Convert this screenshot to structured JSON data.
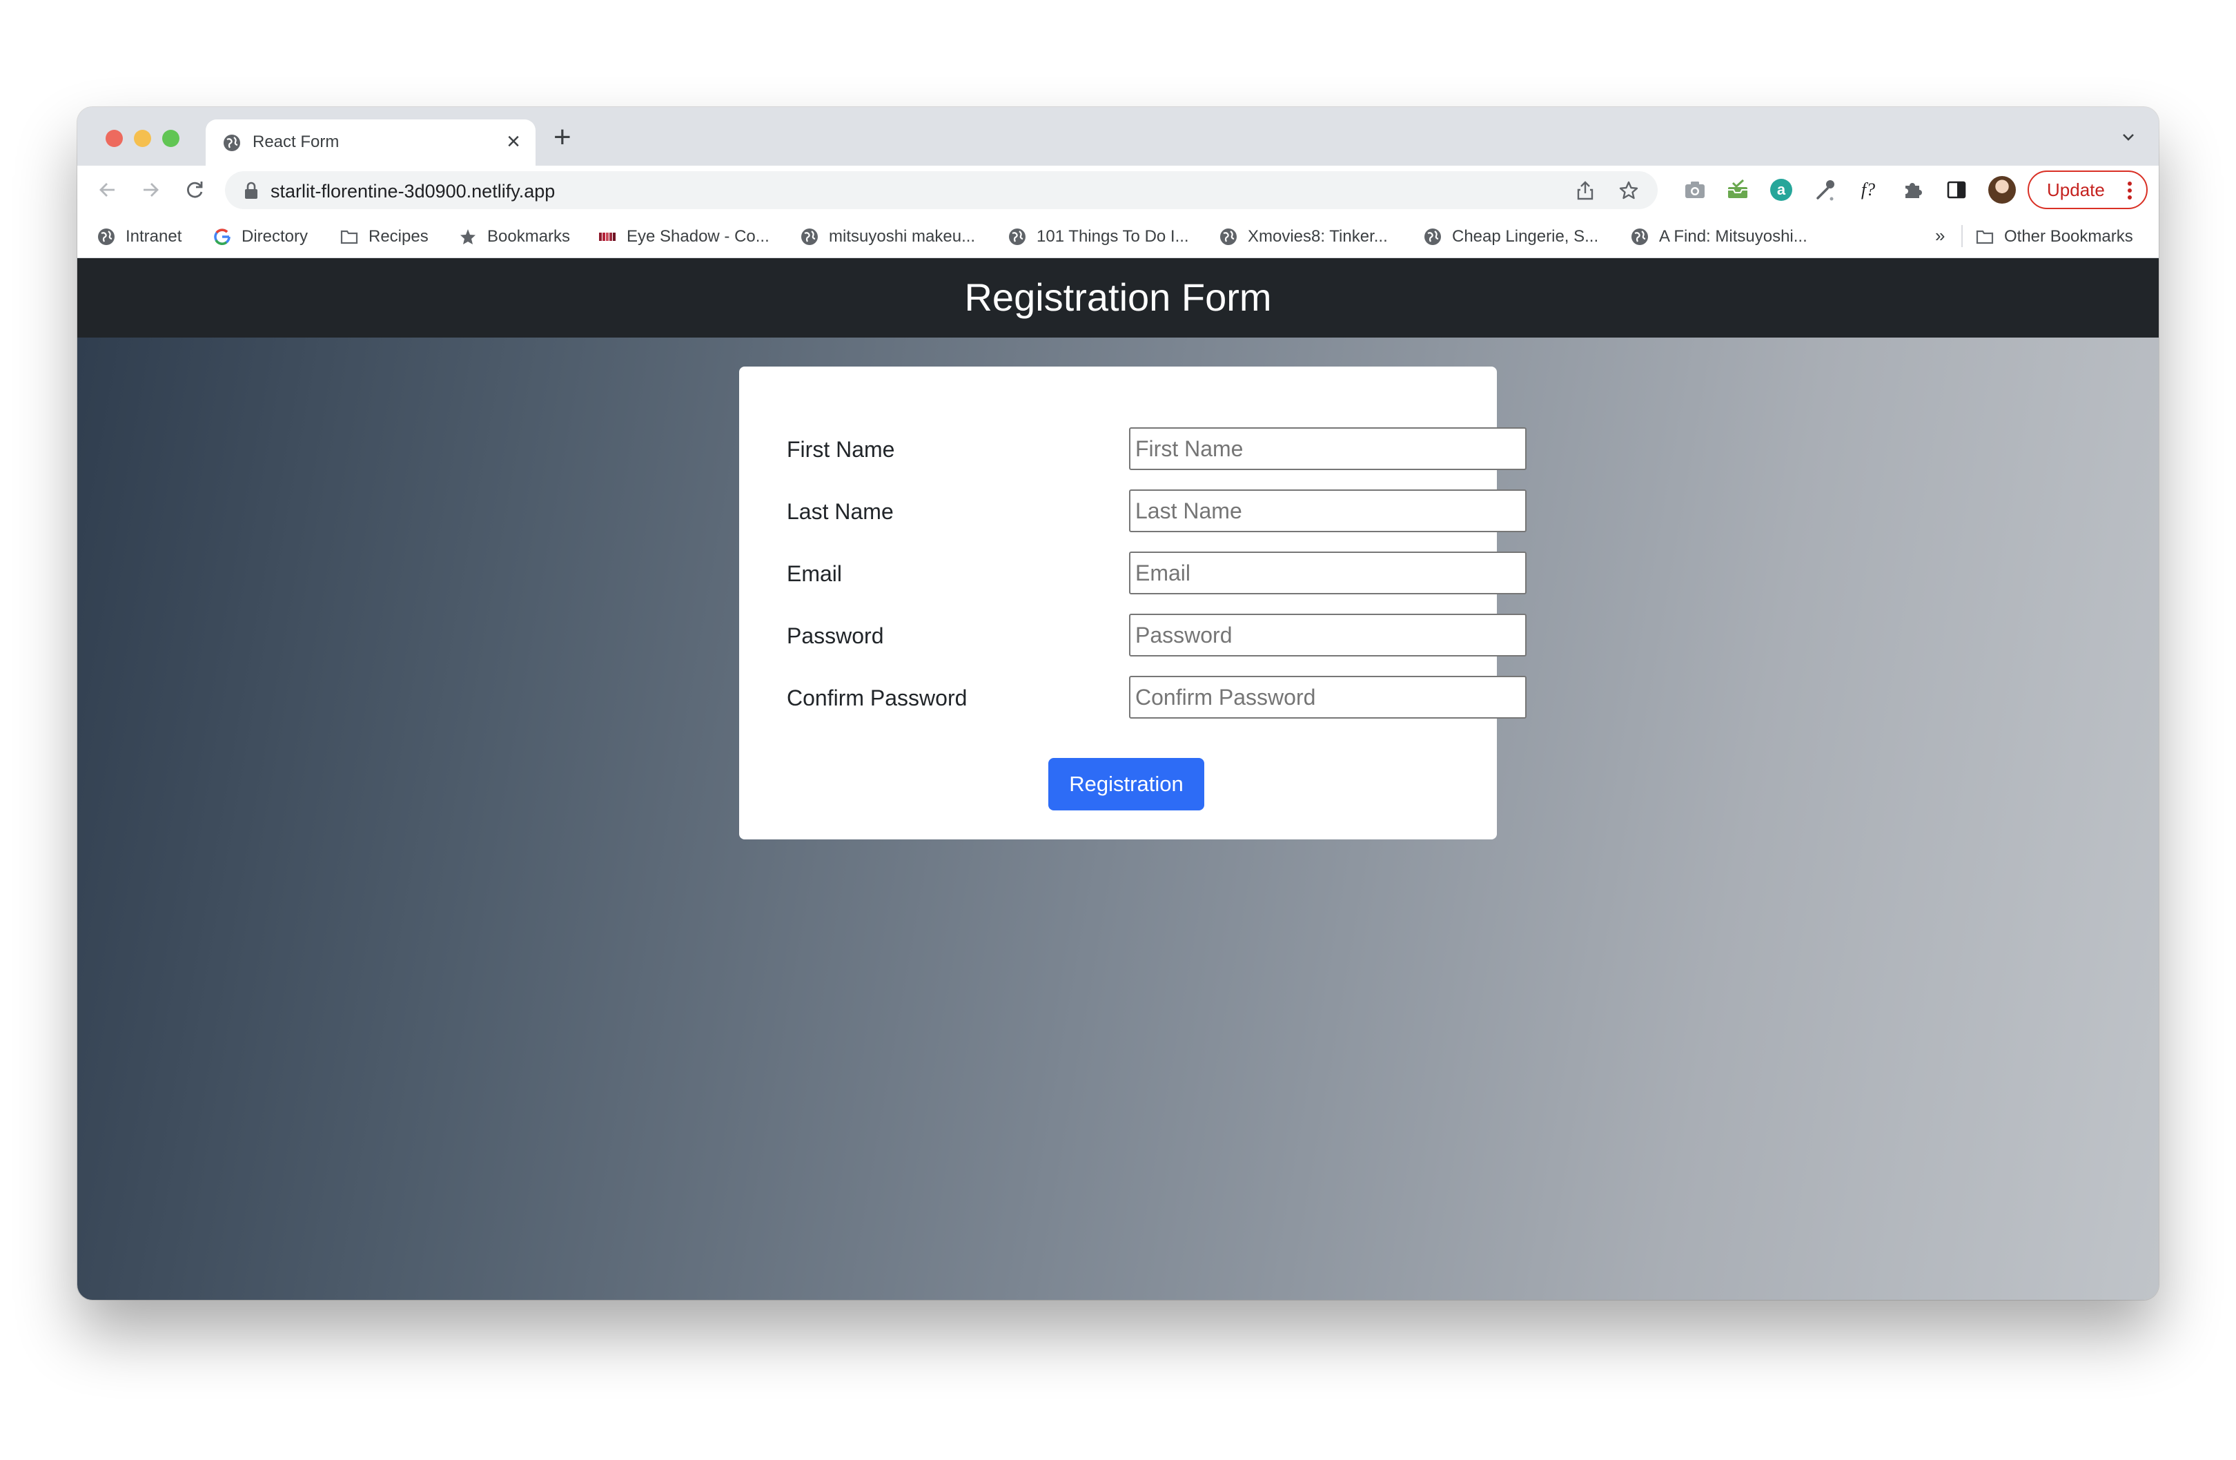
{
  "browser": {
    "tab": {
      "title": "React Form",
      "close_glyph": "×"
    },
    "new_tab_glyph": "+",
    "url": "starlit-florentine-3d0900.netlify.app",
    "update_label": "Update",
    "bookmarks": [
      {
        "label": "Intranet",
        "icon": "globe-icon"
      },
      {
        "label": "Directory",
        "icon": "google-icon"
      },
      {
        "label": "Recipes",
        "icon": "folder-icon"
      },
      {
        "label": "Bookmarks",
        "icon": "star-icon"
      },
      {
        "label": "Eye Shadow - Co...",
        "icon": "palette-icon"
      },
      {
        "label": "mitsuyoshi makeu...",
        "icon": "globe-icon"
      },
      {
        "label": "101 Things To Do I...",
        "icon": "globe-icon"
      },
      {
        "label": "Xmovies8: Tinker...",
        "icon": "globe-icon"
      },
      {
        "label": "Cheap Lingerie, S...",
        "icon": "globe-icon"
      },
      {
        "label": "A Find: Mitsuyoshi...",
        "icon": "globe-icon"
      }
    ],
    "bookmarks_overflow": "»",
    "other_bookmarks": "Other Bookmarks",
    "colors": {
      "update_accent": "#d93025",
      "tab_strip": "#dee1e6"
    }
  },
  "page": {
    "title": "Registration Form",
    "form": {
      "fields": [
        {
          "label": "First Name",
          "placeholder": "First Name",
          "value": ""
        },
        {
          "label": "Last Name",
          "placeholder": "Last Name",
          "value": ""
        },
        {
          "label": "Email",
          "placeholder": "Email",
          "value": ""
        },
        {
          "label": "Password",
          "placeholder": "Password",
          "value": ""
        },
        {
          "label": "Confirm Password",
          "placeholder": "Confirm Password",
          "value": ""
        }
      ],
      "submit_label": "Registration"
    },
    "colors": {
      "header": "#212529",
      "submit": "#2d6cf6"
    }
  }
}
